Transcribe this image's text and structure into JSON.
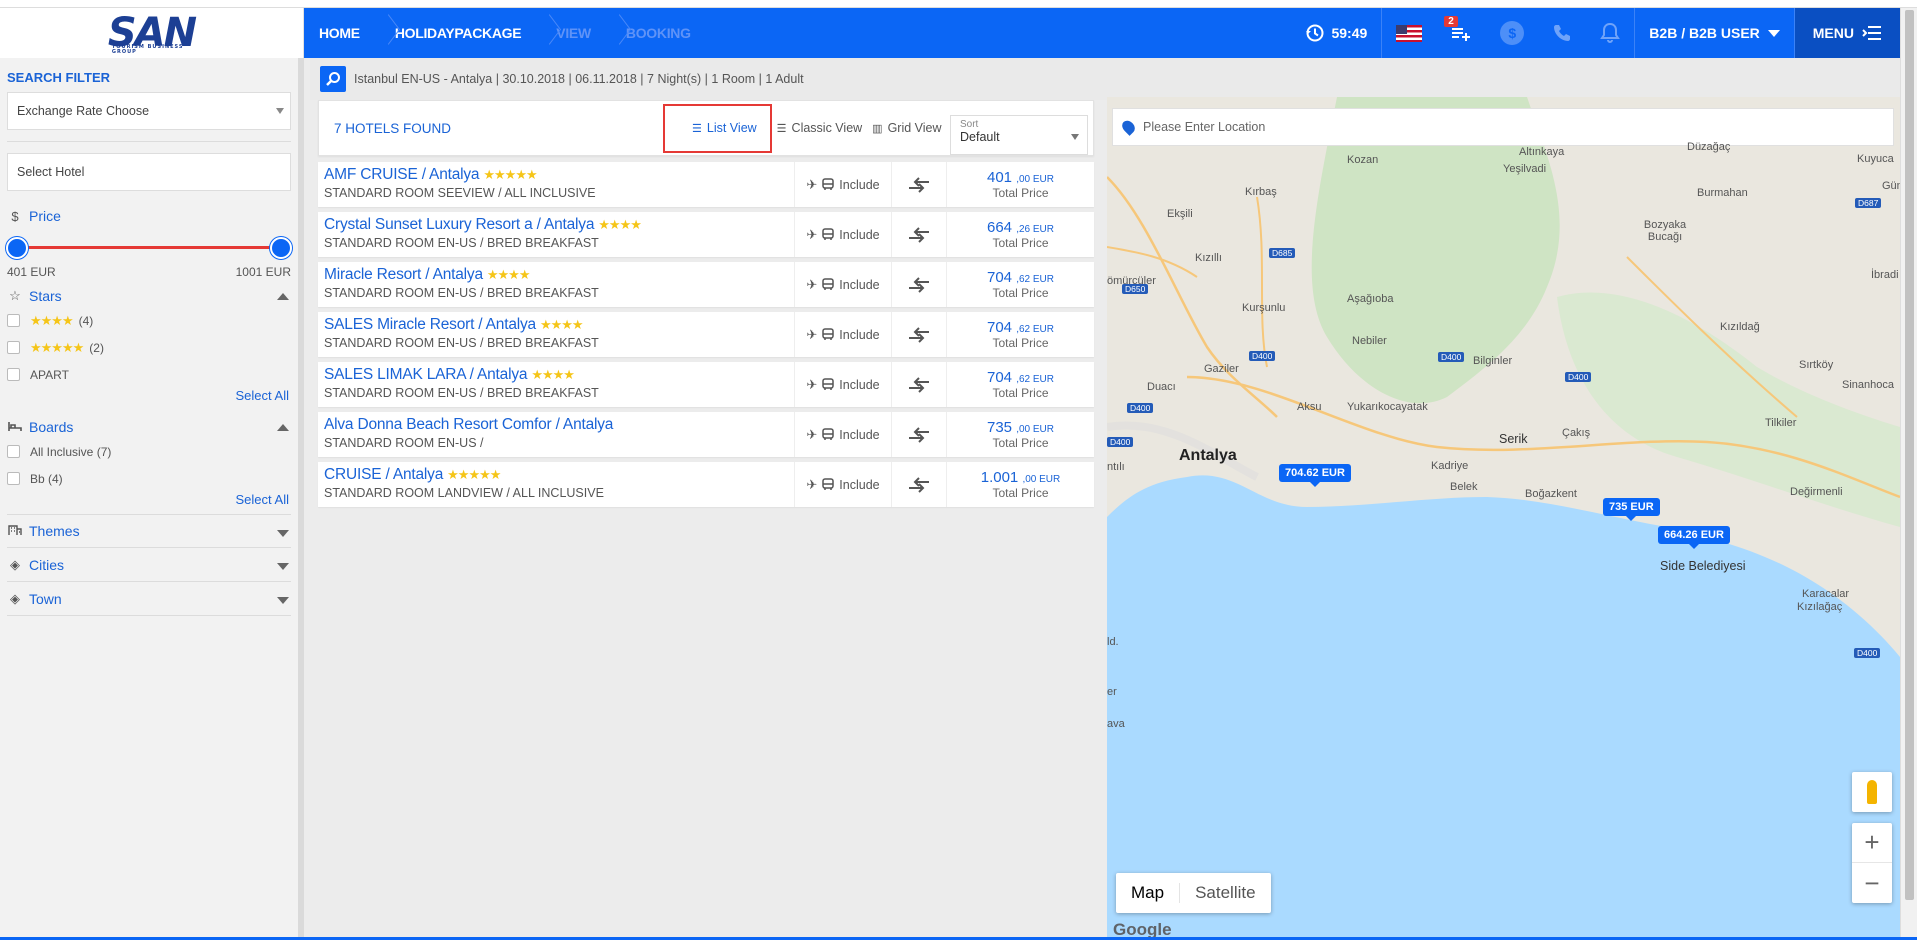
{
  "brand": {
    "logo": "SAN",
    "logo_tagline": "TOURISM BUSINESS GROUP"
  },
  "header": {
    "breadcrumbs": [
      "HOME",
      "HOLIDAYPACKAGE",
      "VIEW",
      "BOOKING"
    ],
    "timer": "59:49",
    "basket_count": "2",
    "currency_symbol": "$",
    "user_label": "B2B / B2B USER",
    "menu_label": "MENU"
  },
  "sidebar": {
    "title": "SEARCH FILTER",
    "exchange_select": "Exchange Rate Choose",
    "hotel_placeholder": "Select Hotel",
    "price": {
      "label": "Price",
      "currency_icon": "$",
      "min_label": "401 EUR",
      "max_label": "1001 EUR",
      "range_start": 0.0,
      "range_end": 1.0
    },
    "stars": {
      "label": "Stars",
      "options": [
        {
          "stars": "★★★★",
          "count": "(4)"
        },
        {
          "stars": "★★★★★",
          "count": "(2)"
        },
        {
          "stars": "",
          "count": "APART"
        }
      ],
      "select_all": "Select All"
    },
    "boards": {
      "label": "Boards",
      "options": [
        {
          "label": "All Inclusive (7)"
        },
        {
          "label": "Bb (4)"
        }
      ],
      "select_all": "Select All"
    },
    "themes": "Themes",
    "cities": "Cities",
    "town": "Town"
  },
  "search_summary": "Istanbul EN-US - Antalya | 30.10.2018 | 06.11.2018 | 7 Night(s) | 1 Room | 1 Adult",
  "results": {
    "found_label": "7 HOTELS FOUND",
    "views": [
      "List View",
      "Classic View",
      "Grid View"
    ],
    "sort_label": "Sort",
    "sort_value": "Default",
    "include_label": "Include",
    "total_price_label": "Total Price",
    "hotels": [
      {
        "name": "AMF CRUISE / Antalya",
        "stars": "★★★★★",
        "room": "STANDARD ROOM SEEVIEW / ALL INCLUSIVE",
        "price_int": "401",
        "price_dec": ",00 EUR"
      },
      {
        "name": "Crystal Sunset Luxury Resort a / Antalya",
        "stars": "★★★★",
        "room": "STANDARD ROOM EN-US / BRED BREAKFAST",
        "price_int": "664",
        "price_dec": ",26 EUR"
      },
      {
        "name": "Miracle Resort / Antalya",
        "stars": "★★★★",
        "room": "STANDARD ROOM EN-US / BRED BREAKFAST",
        "price_int": "704",
        "price_dec": ",62 EUR"
      },
      {
        "name": "SALES Miracle Resort / Antalya",
        "stars": "★★★★",
        "room": "STANDARD ROOM EN-US / BRED BREAKFAST",
        "price_int": "704",
        "price_dec": ",62 EUR"
      },
      {
        "name": "SALES LIMAK LARA / Antalya",
        "stars": "★★★★",
        "room": "STANDARD ROOM EN-US / BRED BREAKFAST",
        "price_int": "704",
        "price_dec": ",62 EUR"
      },
      {
        "name": "Alva Donna Beach Resort Comfor / Antalya",
        "stars": "",
        "room": "STANDARD ROOM EN-US /",
        "price_int": "735",
        "price_dec": ",00 EUR"
      },
      {
        "name": "CRUISE / Antalya",
        "stars": "★★★★★",
        "room": "STANDARD ROOM LANDVIEW / ALL INCLUSIVE",
        "price_int": "1.001",
        "price_dec": ",00 EUR"
      }
    ]
  },
  "map": {
    "location_placeholder": "Please Enter Location",
    "labels": {
      "kozan": "Kozan",
      "altinkaya": "Altınkaya",
      "yesilvadi": "Yeşilvadi",
      "duzagac": "Düzağaç",
      "kuyucak": "Kuyuca",
      "kirbas": "Kırbaş",
      "eksili": "Ekşili",
      "burmahan": "Burmahan",
      "bozyaka": "Bozyaka Bucağı",
      "gun": "Gün",
      "kizilli": "Kızıllı",
      "ibradi": "İbradi",
      "somurcular": "ömürcüler",
      "kursunlu": "Kurşunlu",
      "asagioba": "Aşağıoba",
      "nebiler": "Nebiler",
      "kizildag": "Kızıldağ",
      "bilginler": "Bilginler",
      "sirtkoy": "Sırtköy",
      "gaziler": "Gaziler",
      "sinanhoca": "Sinanhoca",
      "duaci": "Duacı",
      "aksu": "Aksu",
      "yukarikocayatak": "Yukarıkocayatak",
      "tilkiler": "Tilkiler",
      "serik": "Serik",
      "cakis": "Çakış",
      "antalya": "Antalya",
      "kadriye": "Kadriye",
      "belek": "Belek",
      "bogazkent": "Boğazkent",
      "degirmenli": "Değirmenli",
      "side": "Side Belediyesi",
      "karacalar": "Karacalar",
      "kizilagac": "Kızılağaç",
      "ntili": "ntılı",
      "ald": "ld.",
      "ava": "ava",
      "er": "er"
    },
    "roads": [
      "D687",
      "D685",
      "D650",
      "D400",
      "D400",
      "D400",
      "D400",
      "D400",
      "D400"
    ],
    "price_pins": [
      "704.62 EUR",
      "735 EUR",
      "664.26 EUR"
    ],
    "map_type": [
      "Map",
      "Satellite"
    ],
    "zoom_in": "+",
    "zoom_out": "−",
    "google": "Google"
  }
}
